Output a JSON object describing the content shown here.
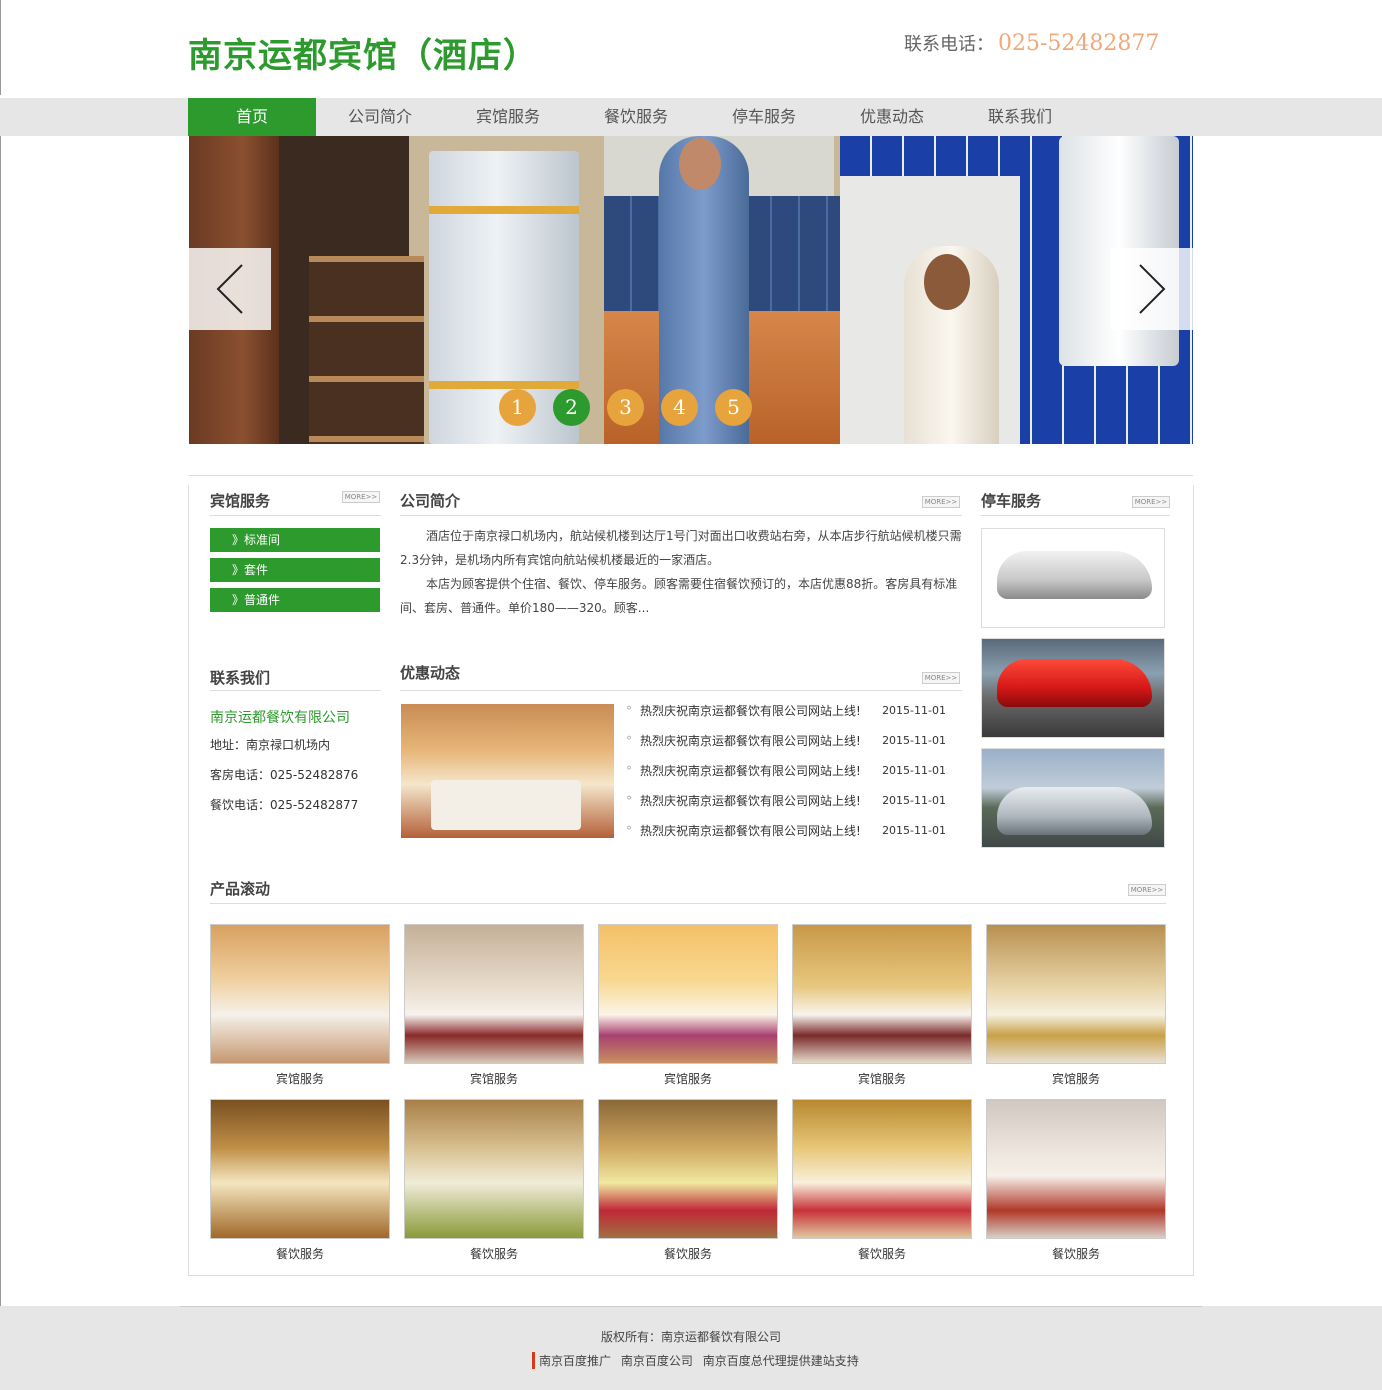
{
  "header": {
    "title": "南京运都宾馆（酒店）",
    "phone_label": "联系电话：",
    "phone_number": "025-52482877"
  },
  "nav": {
    "items": [
      "首页",
      "公司简介",
      "宾馆服务",
      "餐饮服务",
      "停车服务",
      "优惠动态",
      "联系我们"
    ],
    "active": "首页"
  },
  "banner": {
    "prev_icon": "chevron-left",
    "next_icon": "chevron-right",
    "dots": [
      "1",
      "2",
      "3",
      "4",
      "5"
    ],
    "active_dot": "2",
    "colors": {
      "active": "#2c9a2c",
      "inactive": "#e8a43c"
    }
  },
  "more_label": "MORE>>",
  "hotel_services": {
    "title": "宾馆服务",
    "items": [
      "》标准间",
      "》套件",
      "》普通件"
    ]
  },
  "contact": {
    "title": "联系我们",
    "company": "南京运都餐饮有限公司",
    "address": "地址：南京禄口机场内",
    "room_phone": "客房电话：025-52482876",
    "dining_phone": "餐饮电话：025-52482877"
  },
  "intro": {
    "title": "公司简介",
    "paragraph1": "酒店位于南京禄口机场内，航站候机楼到达厅1号门对面出口收费站右旁，从本店步行航站候机楼只需2.3分钟，是机场内所有宾馆向航站候机楼最近的一家酒店。",
    "paragraph2": "本店为顾客提供个住宿、餐饮、停车服务。顾客需要住宿餐饮预订的，本店优惠88折。客房具有标准间、套房、普通件。单价180——320。顾客..."
  },
  "promotions": {
    "title": "优惠动态",
    "items": [
      {
        "title": "热烈庆祝南京运都餐饮有限公司网站上线!",
        "date": "2015-11-01"
      },
      {
        "title": "热烈庆祝南京运都餐饮有限公司网站上线!",
        "date": "2015-11-01"
      },
      {
        "title": "热烈庆祝南京运都餐饮有限公司网站上线!",
        "date": "2015-11-01"
      },
      {
        "title": "热烈庆祝南京运都餐饮有限公司网站上线!",
        "date": "2015-11-01"
      },
      {
        "title": "热烈庆祝南京运都餐饮有限公司网站上线!",
        "date": "2015-11-01"
      }
    ]
  },
  "parking": {
    "title": "停车服务"
  },
  "products": {
    "title": "产品滚动",
    "row1": [
      "宾馆服务",
      "宾馆服务",
      "宾馆服务",
      "宾馆服务",
      "宾馆服务"
    ],
    "row2": [
      "餐饮服务",
      "餐饮服务",
      "餐饮服务",
      "餐饮服务",
      "餐饮服务"
    ]
  },
  "footer": {
    "copyright": "版权所有：南京运都餐饮有限公司",
    "links": [
      "南京百度推广",
      "南京百度公司",
      "南京百度总代理提供建站支持"
    ]
  }
}
